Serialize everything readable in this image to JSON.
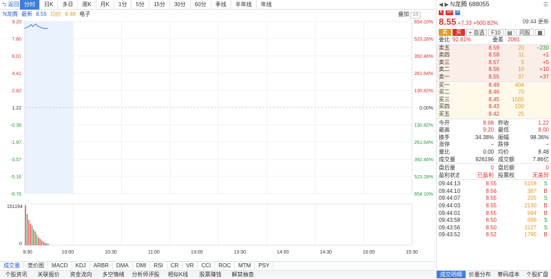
{
  "topbar": {
    "back_label": "返回",
    "tabs": [
      "分时",
      "日K",
      "多日",
      "周K",
      "月K",
      "1分",
      "5分",
      "15分",
      "30分",
      "60分",
      "季线",
      "半年线",
      "年线"
    ]
  },
  "info": {
    "name": "N龙腾",
    "latest_label": "最新",
    "latest": "8.55",
    "avg_label": "均价",
    "avg": "8.48",
    "sector": "电子",
    "overlay_label": "叠加",
    "overlay_tag": "1/5"
  },
  "chart": {
    "left_labels": [
      "9.20",
      "7.60",
      "6.01",
      "4.41",
      "2.82",
      "1.22",
      "-0.38",
      "-1.97",
      "-3.57",
      "-5.16",
      "-6.76"
    ],
    "right_labels": [
      "654.10%",
      "523.28%",
      "392.46%",
      "261.64%",
      "130.82%",
      "0.00%",
      "130.82%",
      "261.64%",
      "392.46%",
      "523.28%",
      "654.10%"
    ],
    "vol_max": "151194",
    "vol_zero": "0",
    "time_labels": [
      "9:30",
      "10:00",
      "10:30",
      "11:00",
      "13:00",
      "13:30",
      "14:00",
      "14:30",
      "15:00",
      "15:30"
    ],
    "colors": {
      "up": "#e0302b",
      "down": "#2a9a3c",
      "line": "#3f7fdb",
      "avg": "#e29a2a"
    }
  },
  "chart_data": {
    "type": "line",
    "x": [
      "09:30",
      "09:31",
      "09:32",
      "09:33",
      "09:34",
      "09:35",
      "09:36",
      "09:37",
      "09:38",
      "09:39",
      "09:40",
      "09:41",
      "09:42",
      "09:43",
      "09:44"
    ],
    "series": [
      {
        "values": [
          8.55,
          8.62,
          8.7,
          8.78,
          8.9,
          8.72,
          8.88,
          8.95,
          8.75,
          8.7,
          8.62,
          8.58,
          8.55,
          8.54,
          8.55
        ]
      }
    ],
    "volume": [
      151194,
      118000,
      96000,
      82000,
      74000,
      60000,
      52000,
      40000,
      30000,
      24000,
      18000,
      14000,
      10000,
      8000,
      6000
    ],
    "ylim": [
      -6.76,
      9.2
    ],
    "xlabel": "",
    "ylabel": ""
  },
  "indicators": [
    "成交量",
    "竞价图",
    "MACD",
    "KDJ",
    "ARBR",
    "DMA",
    "DMI",
    "RSI",
    "CR",
    "VR",
    "CCI",
    "ROC",
    "MTM",
    "PSY"
  ],
  "bottom_tabs": [
    "个股资讯",
    "关联报价",
    "资金流向",
    "多空情绪",
    "分析师评股",
    "相似K线",
    "股票赚钱",
    "解禁抽查"
  ],
  "stock": {
    "name": "N龙腾",
    "code": "688055",
    "badges": [
      "K",
      "SH",
      "R"
    ],
    "price": "8.55",
    "change": "+7.33",
    "change_pct": "+600.82%",
    "time": "09:44",
    "time_status": "更新",
    "buttons": {
      "sell": "卖",
      "buy": "买",
      "watch": "+ 自选",
      "f10": "F10",
      "ask": "问股"
    },
    "ratio_label": "委比",
    "ratio": "92.61%",
    "diff_label": "委差",
    "diff": "2081"
  },
  "sell_orders": [
    {
      "label": "卖五",
      "price": "8.59",
      "vol": "20",
      "chg": "−230"
    },
    {
      "label": "卖四",
      "price": "8.58",
      "vol": "11",
      "chg": "+1"
    },
    {
      "label": "卖三",
      "price": "8.57",
      "vol": "5",
      "chg": "+5"
    },
    {
      "label": "卖二",
      "price": "8.56",
      "vol": "10",
      "chg": "+10"
    },
    {
      "label": "卖一",
      "price": "8.55",
      "vol": "37",
      "chg": "+37"
    }
  ],
  "buy_orders": [
    {
      "label": "买一",
      "price": "8.49",
      "vol": "404",
      "chg": ""
    },
    {
      "label": "买二",
      "price": "8.46",
      "vol": "70",
      "chg": ""
    },
    {
      "label": "买三",
      "price": "8.45",
      "vol": "1565",
      "chg": ""
    },
    {
      "label": "买四",
      "price": "8.43",
      "vol": "100",
      "chg": ""
    },
    {
      "label": "买五",
      "price": "8.42",
      "vol": "25",
      "chg": ""
    }
  ],
  "stats": [
    {
      "l1": "今开",
      "v1": "8.68",
      "l2": "昨收",
      "v2": "1.22"
    },
    {
      "l1": "最高",
      "v1": "9.20",
      "l2": "最低",
      "v2": "8.00"
    },
    {
      "l1": "换手",
      "v1": "34.38%",
      "l2": "振幅",
      "v2": "98.36%"
    },
    {
      "l1": "涨停",
      "v1": "−",
      "l2": "跌停",
      "v2": "−"
    },
    {
      "l1": "量比",
      "v1": "0.00",
      "l2": "均价",
      "v2": "8.48"
    },
    {
      "l1": "成交量",
      "v1": "926196",
      "l2": "成交额",
      "v2": "7.86亿"
    }
  ],
  "after": [
    {
      "l1": "盘后量",
      "v1": "0",
      "l2": "盘后额",
      "v2": "0"
    },
    {
      "l1": "盈利状态",
      "v1": "已盈利",
      "l2": "投票权",
      "v2": "无差异"
    }
  ],
  "ticks": [
    {
      "time": "09:44:13",
      "price": "8.55",
      "vol": "5158",
      "dir": "S"
    },
    {
      "time": "09:44:10",
      "price": "8.56",
      "vol": "387",
      "dir": "B"
    },
    {
      "time": "09:44:07",
      "price": "8.55",
      "vol": "205",
      "dir": "S"
    },
    {
      "time": "09:44:03",
      "price": "8.55",
      "vol": "2130",
      "dir": "B"
    },
    {
      "time": "09:44:01",
      "price": "8.55",
      "vol": "994",
      "dir": "B"
    },
    {
      "time": "09:43:58",
      "price": "8.50",
      "vol": "699",
      "dir": "S"
    },
    {
      "time": "09:43:56",
      "price": "8.50",
      "vol": "1127",
      "dir": "S"
    },
    {
      "time": "09:43:52",
      "price": "8.52",
      "vol": "1795",
      "dir": "B"
    }
  ],
  "rp_bottom_tabs": [
    "成交明细",
    "价量分布",
    "筹码成本",
    "个股扩盘"
  ]
}
